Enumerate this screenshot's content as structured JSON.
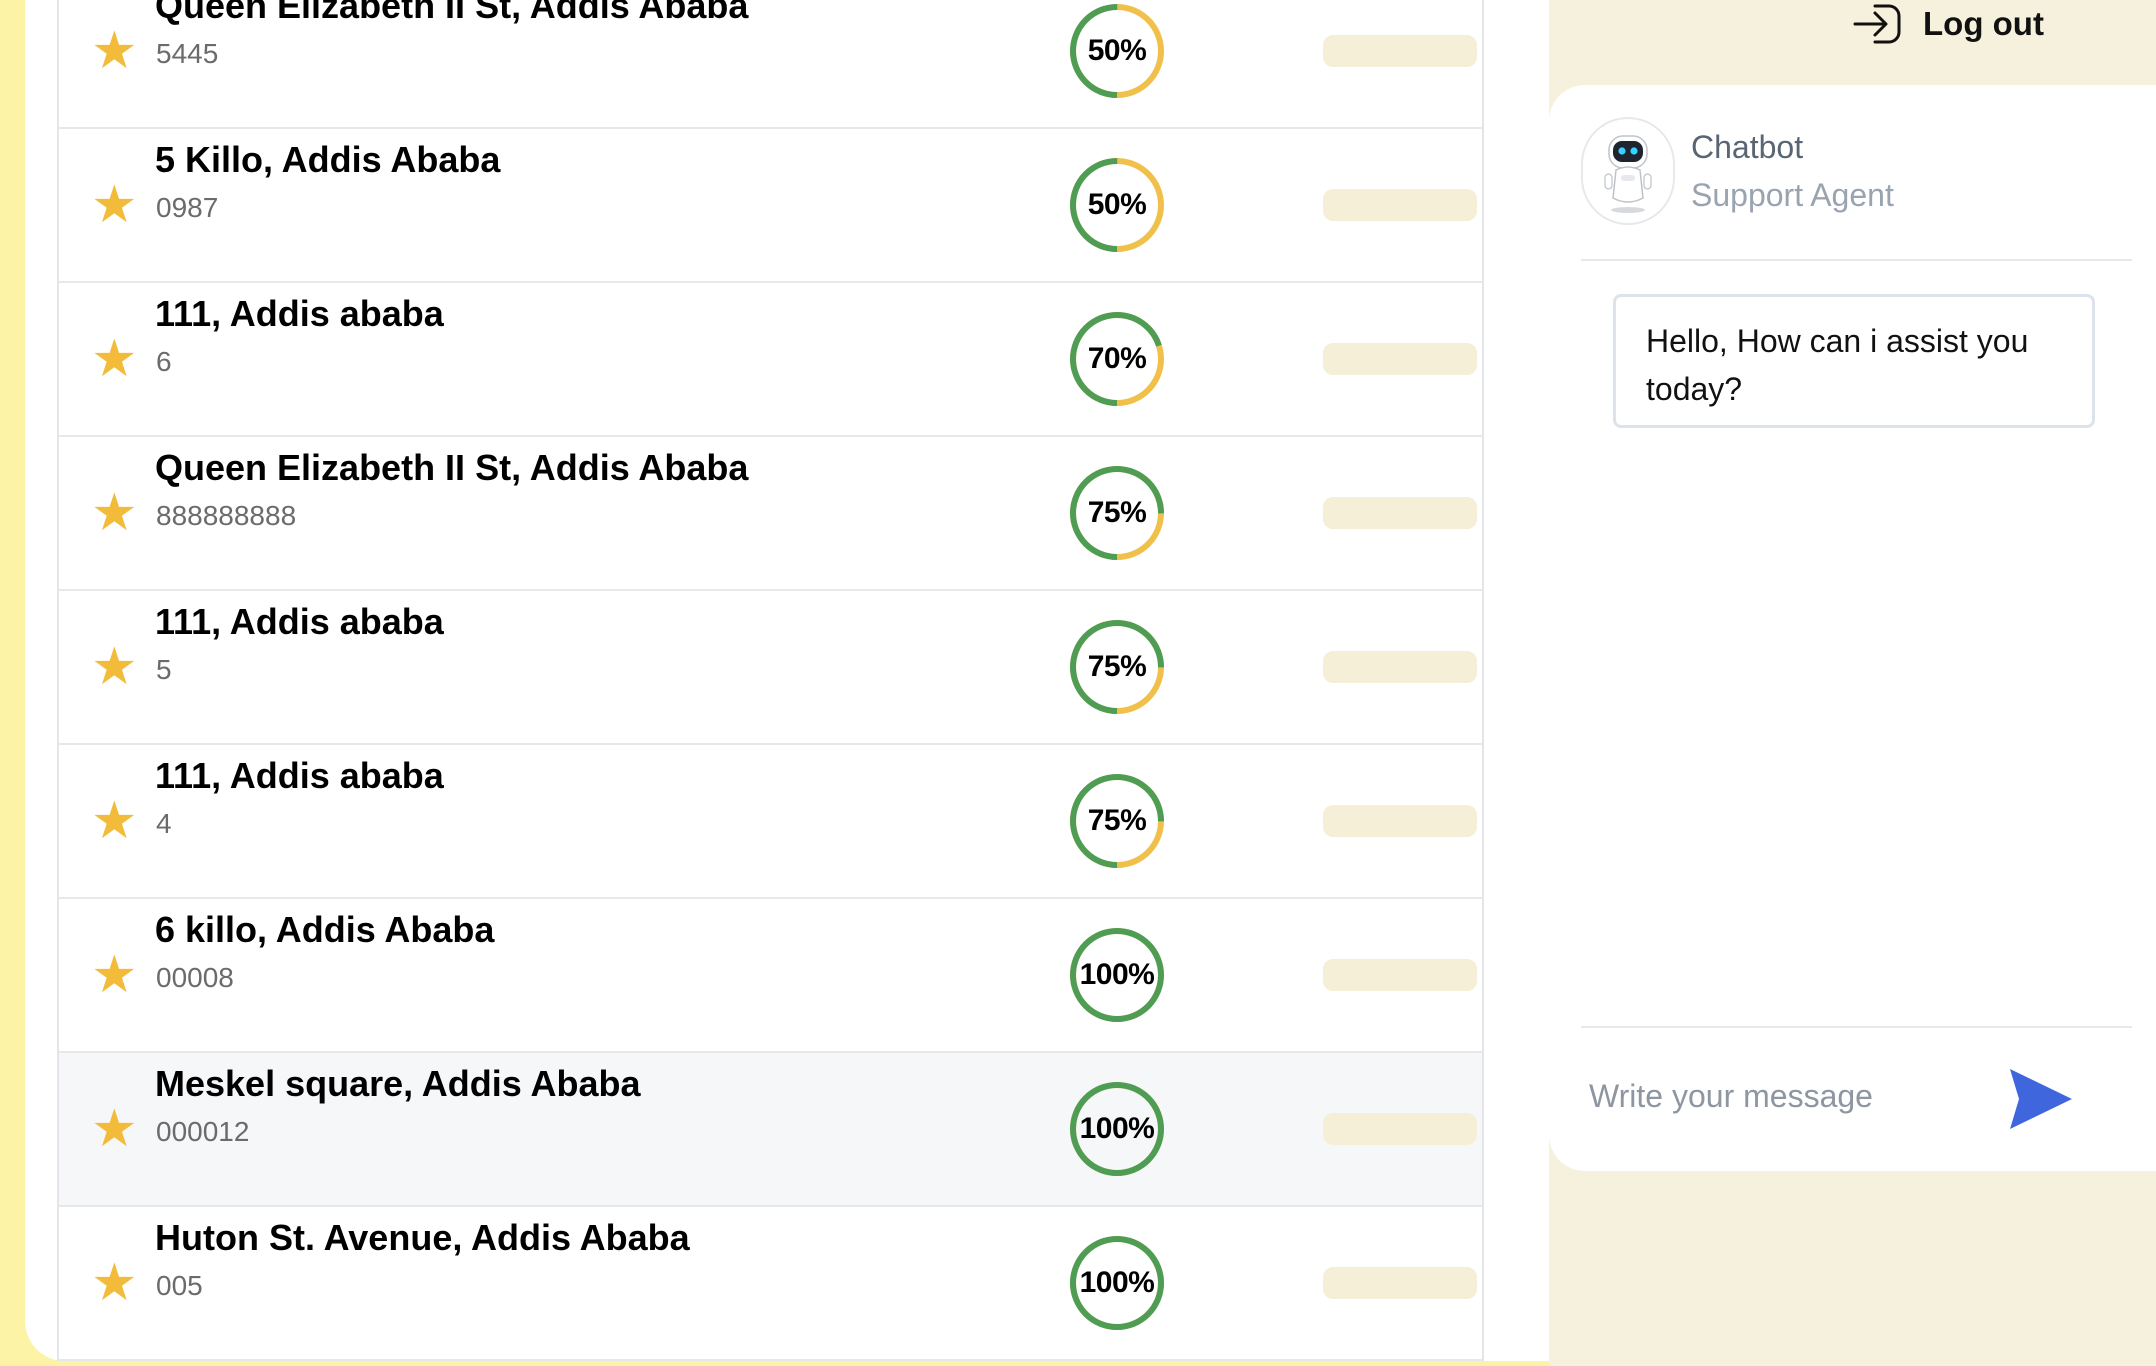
{
  "rows": [
    {
      "title": "Queen Elizabeth II St, Addis Ababa",
      "code": "5445",
      "percent_label": "50%",
      "progress": 50
    },
    {
      "title": "5 Killo, Addis Ababa",
      "code": "0987",
      "percent_label": "50%",
      "progress": 50
    },
    {
      "title": "111, Addis ababa",
      "code": "6",
      "percent_label": "70%",
      "progress": 70
    },
    {
      "title": "Queen Elizabeth II St, Addis Ababa",
      "code": "888888888",
      "percent_label": "75%",
      "progress": 75
    },
    {
      "title": "111, Addis ababa",
      "code": "5",
      "percent_label": "75%",
      "progress": 75
    },
    {
      "title": "111, Addis ababa",
      "code": "4",
      "percent_label": "75%",
      "progress": 75
    },
    {
      "title": "6 killo, Addis Ababa",
      "code": "00008",
      "percent_label": "100%",
      "progress": 100
    },
    {
      "title": "Meskel square, Addis Ababa",
      "code": "000012",
      "percent_label": "100%",
      "progress": 100
    },
    {
      "title": "Huton St. Avenue, Addis Ababa",
      "code": "005",
      "percent_label": "100%",
      "progress": 100
    }
  ],
  "row_icon": "star-icon",
  "header": {
    "logout_label": "Log out",
    "logout_icon": "log-out-icon"
  },
  "chat": {
    "agent_name": "Chatbot",
    "agent_role": "Support Agent",
    "avatar_icon": "robot-avatar-icon",
    "greeting": "Hello, How can i assist you today?",
    "input_placeholder": "Write your message",
    "send_icon": "send-icon"
  },
  "colors": {
    "page_background": "#fdf3a7",
    "sidebar_background": "#f5f1dc",
    "star": "#f2bc3a",
    "progress_complete": "#4f9d55",
    "progress_remaining": "#f0c04a",
    "placeholder_bar": "#f5efd7",
    "send_button": "#3f66dd"
  }
}
